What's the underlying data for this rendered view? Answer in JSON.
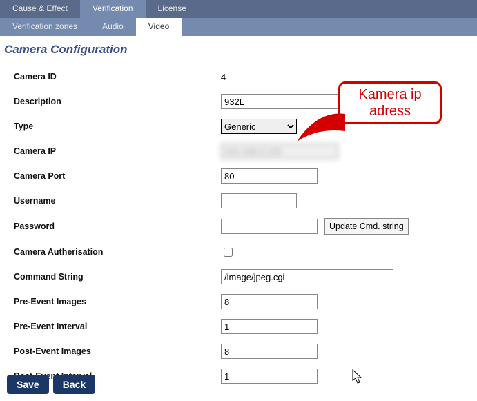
{
  "tabs_primary": {
    "cause_effect": "Cause & Effect",
    "verification": "Verification",
    "license": "License"
  },
  "tabs_secondary": {
    "zones": "Verification zones",
    "audio": "Audio",
    "video": "Video"
  },
  "page_title": "Camera Configuration",
  "labels": {
    "camera_id": "Camera ID",
    "description": "Description",
    "type": "Type",
    "camera_ip": "Camera IP",
    "camera_port": "Camera Port",
    "username": "Username",
    "password": "Password",
    "camera_auth": "Camera Autherisation",
    "command_string": "Command String",
    "pre_event_images": "Pre-Event Images",
    "pre_event_interval": "Pre-Event Interval",
    "post_event_images": "Post-Event Images",
    "post_event_interval": "Post-Event Interval"
  },
  "values": {
    "camera_id": "4",
    "description": "932L",
    "type": "Generic",
    "camera_ip": "192.168.0.100",
    "camera_port": "80",
    "username": "",
    "password": "",
    "camera_auth": false,
    "command_string": "/image/jpeg.cgi",
    "pre_event_images": "8",
    "pre_event_interval": "1",
    "post_event_images": "8",
    "post_event_interval": "1"
  },
  "buttons": {
    "update_cmd": "Update Cmd. string",
    "save": "Save",
    "back": "Back"
  },
  "callout": "Kamera ip adress"
}
